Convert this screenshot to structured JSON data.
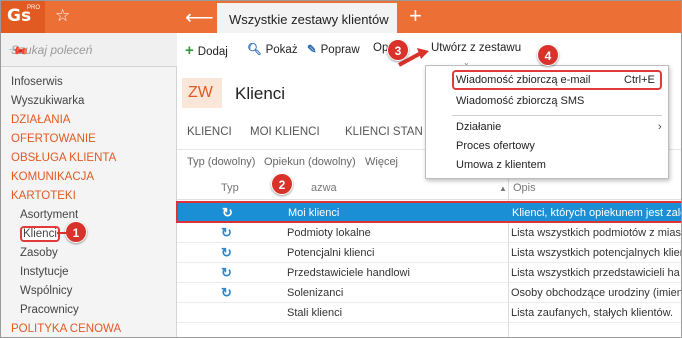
{
  "app": {
    "logo": "Gs",
    "logo_suffix": "PRO"
  },
  "tabs_top": {
    "active_tab": "Wszystkie zestawy klientów"
  },
  "sidebar": {
    "search_placeholder": "Szukaj poleceń",
    "items": [
      {
        "label": "Infoserwis",
        "type": "item"
      },
      {
        "label": "Wyszukiwarka",
        "type": "item"
      },
      {
        "label": "DZIAŁANIA",
        "type": "section"
      },
      {
        "label": "OFERTOWANIE",
        "type": "section"
      },
      {
        "label": "OBSŁUGA KLIENTA",
        "type": "section"
      },
      {
        "label": "KOMUNIKACJA",
        "type": "section"
      },
      {
        "label": "KARTOTEKI",
        "type": "section"
      },
      {
        "label": "Asortyment",
        "type": "sub"
      },
      {
        "label": "Klienci",
        "type": "sub-selected"
      },
      {
        "label": "Zasoby",
        "type": "sub"
      },
      {
        "label": "Instytucje",
        "type": "sub"
      },
      {
        "label": "Wspólnicy",
        "type": "sub"
      },
      {
        "label": "Pracownicy",
        "type": "sub"
      },
      {
        "label": "POLITYKA CENOWA",
        "type": "section"
      }
    ]
  },
  "toolbar": {
    "add": "Dodaj",
    "show": "Pokaż",
    "fix": "Popraw",
    "ops": "Op",
    "ops_tail": "e",
    "create_from_set": "Utwórz z zestawu"
  },
  "title_area": {
    "badge": "ZW",
    "title": "Klienci"
  },
  "list_tabs": [
    "KLIENCI",
    "MOI KLIENCI",
    "KLIENCI STAN"
  ],
  "filters": [
    "Typ (dowolny)",
    "Opiekun (dowolny)",
    "Więcej"
  ],
  "table": {
    "headers": {
      "type": "Typ",
      "name": "Nazwa",
      "name_visible": "azwa",
      "desc": "Opis",
      "sort_glyph": "▲"
    },
    "rows": [
      {
        "icon": "refresh-icon",
        "name": "Moi klienci",
        "desc": "Klienci, których opiekunem jest zalo"
      },
      {
        "icon": "refresh-icon",
        "name": "Podmioty lokalne",
        "desc": "Lista wszystkich podmiotów z miast"
      },
      {
        "icon": "refresh-icon",
        "name": "Potencjalni klienci",
        "desc": "Lista wszystkich potencjalnych klien"
      },
      {
        "icon": "refresh-icon",
        "name": "Przedstawiciele handlowi",
        "desc": "Lista wszystkich przedstawicieli ha"
      },
      {
        "icon": "refresh-icon",
        "name": "Solenizanci",
        "desc": "Osoby obchodzące urodziny (imien"
      },
      {
        "icon": "",
        "name": "Stali klienci",
        "desc": "Lista zaufanych, stałych klientów."
      }
    ]
  },
  "dropdown": {
    "items": [
      {
        "label": "Wiadomość zbiorczą e-mail",
        "shortcut": "Ctrl+E"
      },
      {
        "label": "Wiadomość zbiorczą SMS"
      },
      {
        "label": "Działanie",
        "submenu": "›"
      },
      {
        "label": "Proces ofertowy"
      },
      {
        "label": "Umowa z klientem"
      }
    ]
  },
  "badges": [
    "1",
    "2",
    "3",
    "4"
  ],
  "colors": {
    "brand": "#ec6f36",
    "selection": "#1b8fd6",
    "annotation": "#d9322b"
  }
}
